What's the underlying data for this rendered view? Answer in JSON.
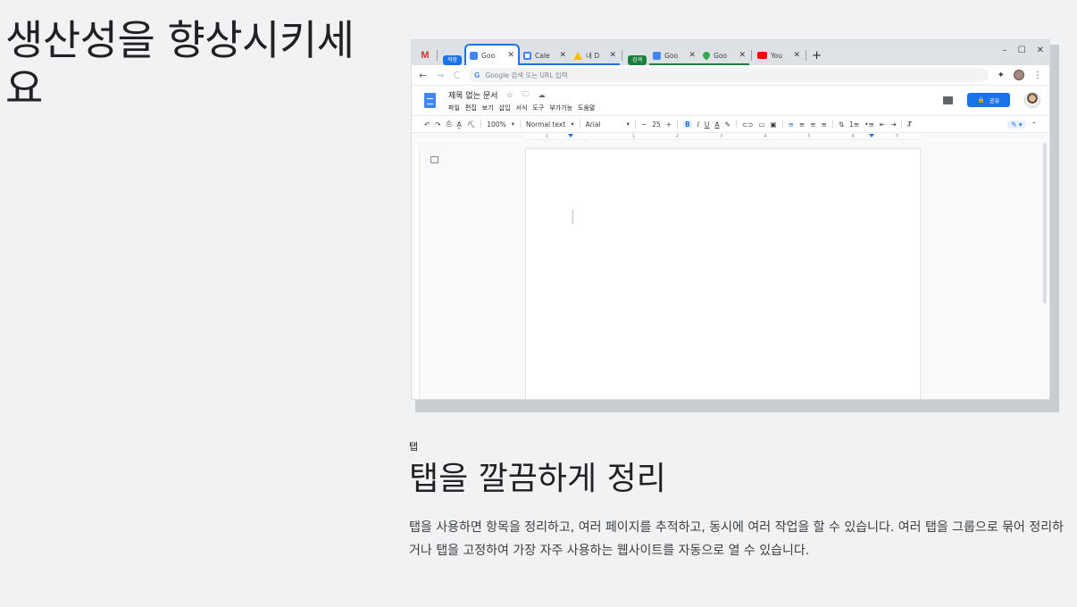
{
  "headline": "생산성을 향상시키세요",
  "browser": {
    "tabs": [
      {
        "type": "gmail",
        "icon": "gmail-icon",
        "label": "M"
      },
      {
        "type": "group",
        "label": "직장",
        "color": "#1a73e8"
      },
      {
        "type": "tab",
        "title": "Goo",
        "icon": "docs-icon",
        "active": true
      },
      {
        "type": "tab",
        "title": "Cale",
        "icon": "calendar-icon"
      },
      {
        "type": "tab",
        "title": "내 D",
        "icon": "drive-icon"
      },
      {
        "type": "group",
        "label": "검색",
        "color": "#188038"
      },
      {
        "type": "tab",
        "title": "Goo",
        "icon": "translate-icon"
      },
      {
        "type": "tab",
        "title": "Goo",
        "icon": "maps-icon"
      },
      {
        "type": "tab",
        "title": "You",
        "icon": "youtube-icon"
      }
    ],
    "tab_close": "✕",
    "new_tab": "+",
    "window_controls": {
      "minimize": "–",
      "maximize": "☐",
      "close": "✕"
    },
    "nav": {
      "back": "←",
      "forward": "→",
      "reload": "C"
    },
    "omnibox": {
      "g": "G",
      "placeholder": "Google 검색 또는 URL 입력"
    },
    "extensions": {
      "puzzle": "✦",
      "menu": "⋮"
    }
  },
  "docs": {
    "title": "제목 없는 문서",
    "title_icons": {
      "star": "☆",
      "move": "🗀",
      "cloud": "☁"
    },
    "menus": [
      "파일",
      "편집",
      "보기",
      "삽입",
      "서식",
      "도구",
      "부가기능",
      "도움말"
    ],
    "share_label": "공유",
    "share_lock": "🔒",
    "toolbar": {
      "undo": "↶",
      "redo": "↷",
      "print": "⎙",
      "spell": "A̲",
      "paint": "⛏",
      "zoom": "100%",
      "style": "Normal text",
      "font": "Arial",
      "minus": "−",
      "size": "25",
      "plus": "+",
      "bold": "B",
      "italic": "I",
      "underline": "U",
      "color": "A",
      "highlight": "✎",
      "link": "⊂⊃",
      "comment": "▭",
      "image": "▣",
      "align": [
        "≡",
        "≡",
        "≡",
        "≡"
      ],
      "spacing": "⇅",
      "numbered": "1≡",
      "bulleted": "•≡",
      "outdent": "⇤",
      "indent": "⇥",
      "clear": "T̸",
      "edit_mode": "✎ ▾",
      "collapse": "⌃",
      "dropdown": "▾"
    },
    "ruler_numbers": [
      "1",
      "·",
      "1",
      "2",
      "3",
      "4",
      "5",
      "6",
      "7"
    ]
  },
  "section": {
    "label": "탭",
    "title": "탭을 깔끔하게 정리",
    "body": "탭을 사용하면 항목을 정리하고, 여러 페이지를 추적하고, 동시에 여러 작업을 할 수 있습니다. 여러 탭을 그룹으로 묶어 정리하거나 탭을 고정하여 가장 자주 사용하는 웹사이트를 자동으로 열 수 있습니다."
  }
}
